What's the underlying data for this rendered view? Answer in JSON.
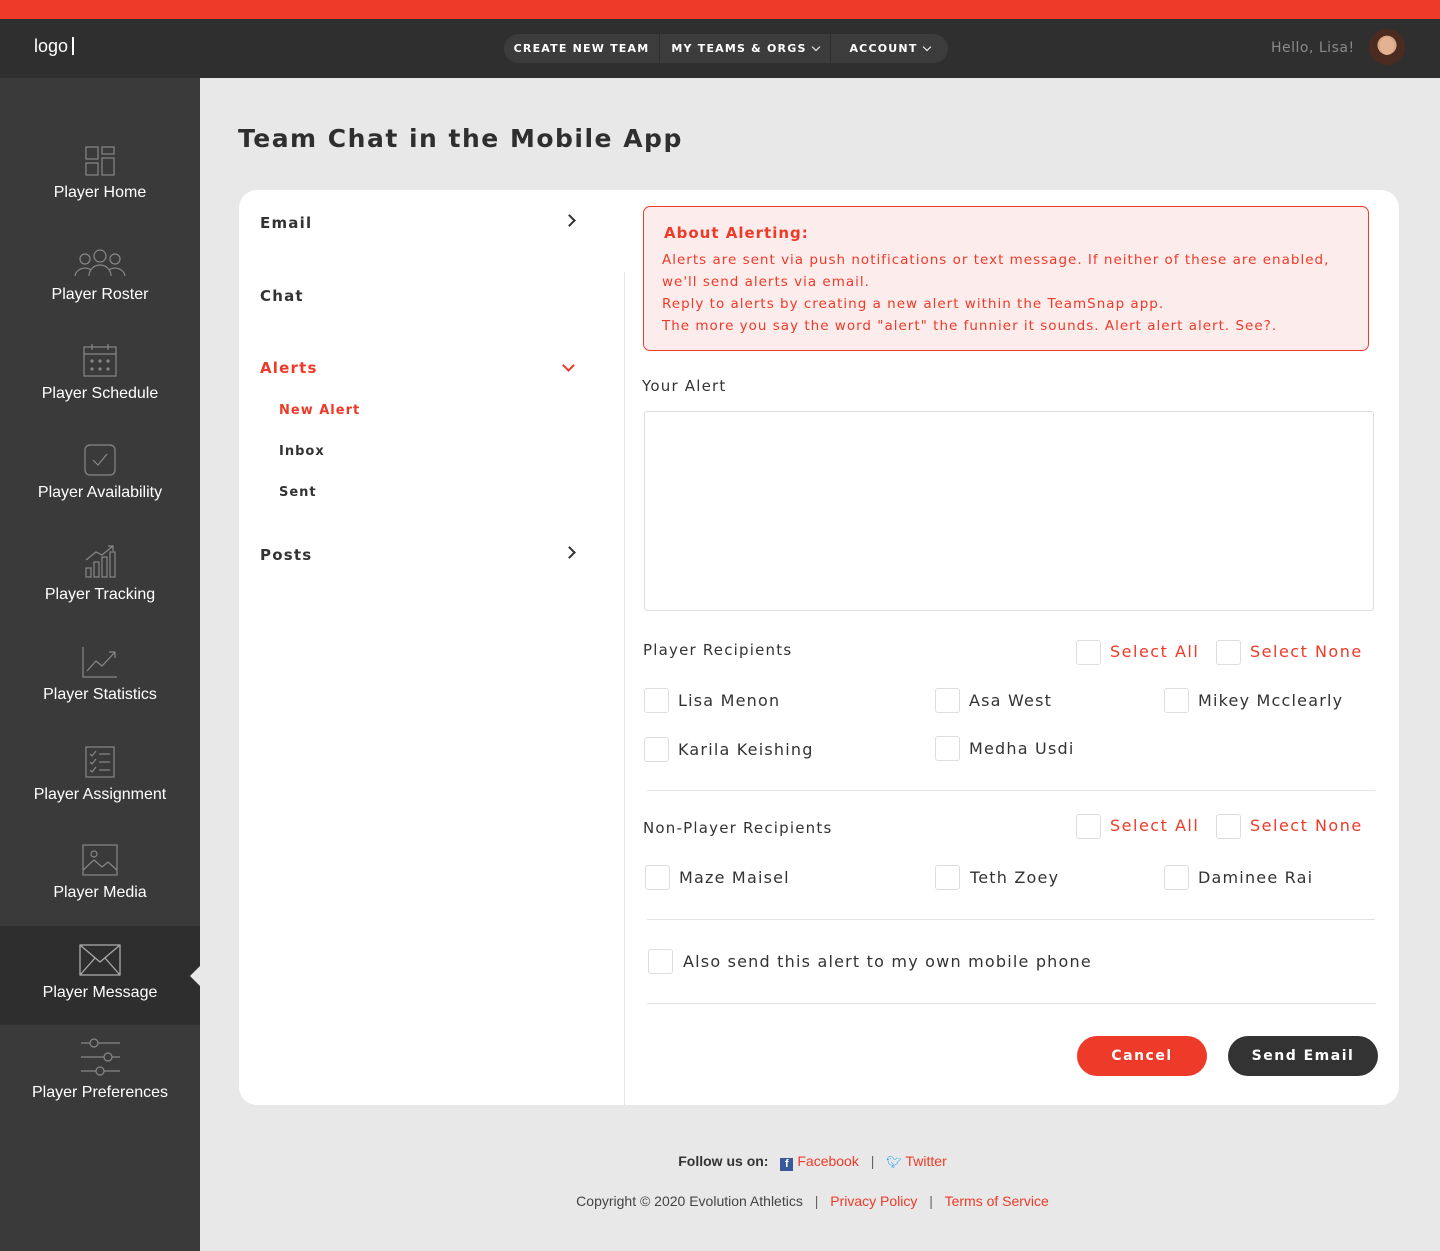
{
  "header": {
    "logo": "logo",
    "nav": [
      {
        "label": "CREATE NEW TEAM",
        "dropdown": false
      },
      {
        "label": "MY TEAMS & ORGS",
        "dropdown": true
      },
      {
        "label": "ACCOUNT",
        "dropdown": true
      }
    ],
    "greeting": "Hello, Lisa!"
  },
  "sidebar": {
    "items": [
      {
        "label": "Player Home",
        "icon": "dashboard-icon"
      },
      {
        "label": "Player Roster",
        "icon": "group-icon"
      },
      {
        "label": "Player Schedule",
        "icon": "calendar-icon"
      },
      {
        "label": "Player Availability",
        "icon": "checkbox-icon"
      },
      {
        "label": "Player Tracking",
        "icon": "bar-chart-icon"
      },
      {
        "label": "Player Statistics",
        "icon": "trend-icon"
      },
      {
        "label": "Player Assignment",
        "icon": "checklist-icon"
      },
      {
        "label": "Player Media",
        "icon": "image-icon"
      },
      {
        "label": "Player Message",
        "icon": "envelope-icon",
        "active": true
      },
      {
        "label": "Player Preferences",
        "icon": "sliders-icon"
      }
    ]
  },
  "page": {
    "title": "Team Chat in the Mobile App"
  },
  "leftnav": {
    "email": "Email",
    "chat": "Chat",
    "alerts": "Alerts",
    "alerts_sub": [
      "New Alert",
      "Inbox",
      "Sent"
    ],
    "posts": "Posts"
  },
  "about": {
    "heading": "About Alerting:",
    "line1": "Alerts are sent via push notifications or text message. If neither of these are enabled, we'll send alerts via email.",
    "line2": "Reply to alerts by creating a new alert within the TeamSnap app.",
    "line3": "The more you say the word \"alert\" the funnier it sounds. Alert alert alert. See?."
  },
  "form": {
    "your_alert_label": "Your Alert",
    "alert_text": "",
    "player_recipients_label": "Player Recipients",
    "non_player_recipients_label": "Non-Player Recipients",
    "select_all": "Select All",
    "select_none": "Select None",
    "players": [
      "Lisa Menon",
      "Asa West",
      "Mikey Mcclearly",
      "Karila Keishing",
      "Medha Usdi"
    ],
    "non_players": [
      "Maze Maisel",
      "Teth Zoey",
      "Daminee Rai"
    ],
    "own_phone_label": "Also send this alert to my own mobile phone",
    "cancel": "Cancel",
    "send": "Send Email"
  },
  "footer": {
    "follow": "Follow us on:",
    "facebook": "Facebook",
    "twitter": "Twitter",
    "copyright": "Copyright © 2020 Evolution Athletics",
    "privacy": "Privacy Policy",
    "terms": "Terms of Service"
  },
  "colors": {
    "accent": "#ee3a28",
    "header_bg": "#2f2f2f",
    "sidebar_bg": "#3a3a3a"
  }
}
